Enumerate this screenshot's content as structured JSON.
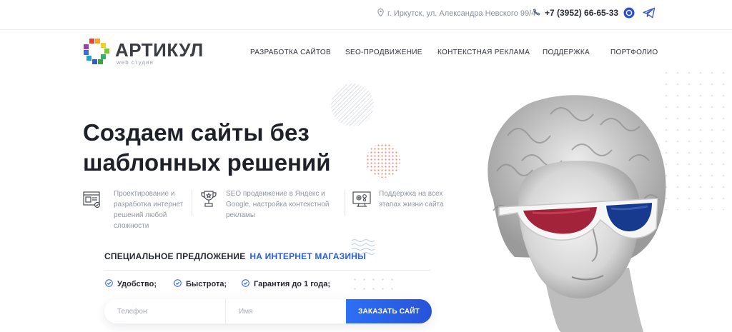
{
  "topbar": {
    "address": "г. Иркутск, ул. Александра Невского 99/4",
    "phone": "+7 (3952) 66-65-33"
  },
  "logo": {
    "name": "АРТИКУЛ",
    "subtitle": "web студия"
  },
  "nav": [
    "РАЗРАБОТКА САЙТОВ",
    "SEO-ПРОДВИЖЕНИЕ",
    "КОНТЕКСТНАЯ РЕКЛАМА",
    "ПОДДЕРЖКА",
    "ПОРТФОЛИО"
  ],
  "hero": {
    "title_line1": "Создаем сайты без",
    "title_line2": "шаблонных решений"
  },
  "features": [
    {
      "line1": "Проектирование и",
      "line2": "разработка интернет",
      "line3": "решений любой",
      "line4": "сложности",
      "icon": "blueprint-icon"
    },
    {
      "line1": "SEO продвижение в Яндекс и",
      "line2": "Google, настройка контекстной",
      "line3": "рекламы",
      "icon": "trophy-icon"
    },
    {
      "line1": "Поддержка на всех",
      "line2": "этапах жизни сайта",
      "icon": "monitor-gears-icon"
    }
  ],
  "offer": {
    "label": "СПЕЦИАЛЬНОЕ ПРЕДЛОЖЕНИЕ",
    "accent": "НА ИНТЕРНЕТ МАГАЗИНЫ"
  },
  "checks": [
    "Удобство;",
    "Быстрота;",
    "Гарантия до 1 года;"
  ],
  "form": {
    "phone_placeholder": "Телефон",
    "name_placeholder": "Имя",
    "submit_label": "ЗАКАЗАТЬ САЙТ"
  },
  "colors": {
    "accent": "#2b5de6",
    "button": "#2c6af2",
    "text": "#1f2128"
  }
}
